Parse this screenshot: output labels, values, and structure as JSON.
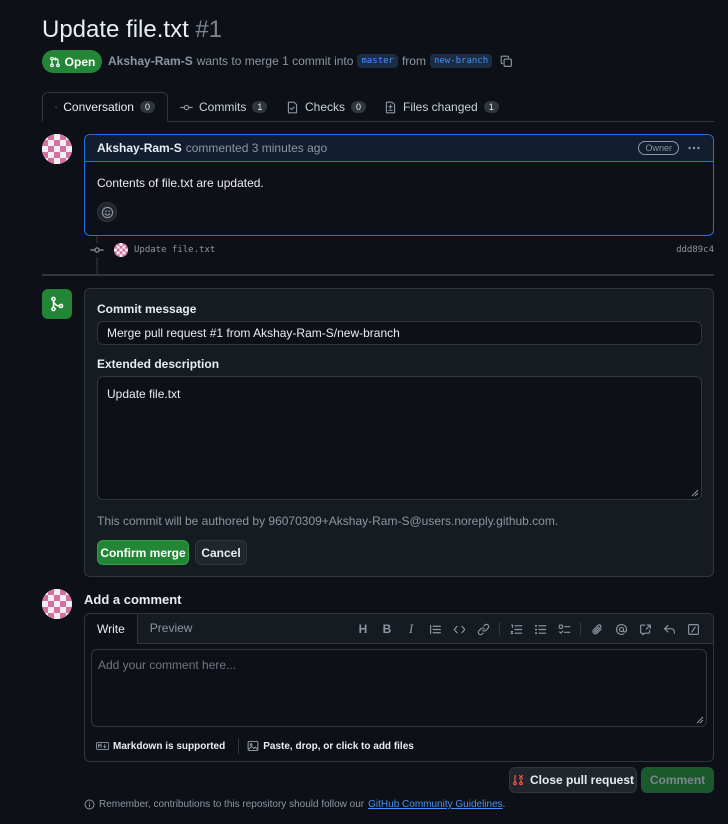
{
  "pr": {
    "title": "Update file.txt",
    "number": "#1",
    "state": "Open",
    "author": "Akshay-Ram-S",
    "meta_text": "wants to merge 1 commit into",
    "base_branch": "master",
    "from_text": "from",
    "head_branch": "new-branch"
  },
  "tabs": [
    {
      "label": "Conversation",
      "count": "0",
      "icon": "comment-discussion-icon"
    },
    {
      "label": "Commits",
      "count": "1",
      "icon": "git-commit-icon"
    },
    {
      "label": "Checks",
      "count": "0",
      "icon": "checklist-icon"
    },
    {
      "label": "Files changed",
      "count": "1",
      "icon": "file-diff-icon"
    }
  ],
  "comment": {
    "author": "Akshay-Ram-S",
    "time": "commented 3 minutes ago",
    "role": "Owner",
    "body": "Contents of file.txt are updated."
  },
  "commit": {
    "message": "Update file.txt",
    "sha": "ddd89c4"
  },
  "merge": {
    "commit_message_label": "Commit message",
    "commit_message_value": "Merge pull request #1 from Akshay-Ram-S/new-branch",
    "extended_label": "Extended description",
    "extended_value": "Update file.txt",
    "author_note": "This commit will be authored by 96070309+Akshay-Ram-S@users.noreply.github.com.",
    "confirm_label": "Confirm merge",
    "cancel_label": "Cancel"
  },
  "add_comment": {
    "title": "Add a comment",
    "write_tab": "Write",
    "preview_tab": "Preview",
    "placeholder": "Add your comment here...",
    "markdown_note": "Markdown is supported",
    "attach_note": "Paste, drop, or click to add files",
    "close_label": "Close pull request",
    "comment_label": "Comment"
  },
  "footer": {
    "tip_text": "Remember, contributions to this repository should follow our",
    "tip_link": "GitHub Community Guidelines",
    "tip_end": "."
  },
  "colors": {
    "background": "#0d1117",
    "accent_green": "#238636",
    "accent_blue": "#1f6feb",
    "close_red": "#f85149"
  }
}
